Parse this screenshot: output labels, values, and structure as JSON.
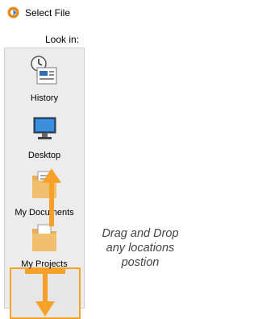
{
  "window": {
    "title": "Select File"
  },
  "look_in_label": "Look in:",
  "places": [
    {
      "label": "History",
      "icon": "history-icon"
    },
    {
      "label": "Desktop",
      "icon": "desktop-icon"
    },
    {
      "label": "My Documents",
      "icon": "documents-folder-icon"
    },
    {
      "label": "My Projects",
      "icon": "projects-folder-icon",
      "highlighted": true
    }
  ],
  "annotation": {
    "lines": [
      "Drag and Drop",
      "any locations",
      "postion"
    ]
  },
  "colors": {
    "accent": "#f7a12a",
    "panel": "#ececec",
    "folder": "#e8b05a"
  }
}
